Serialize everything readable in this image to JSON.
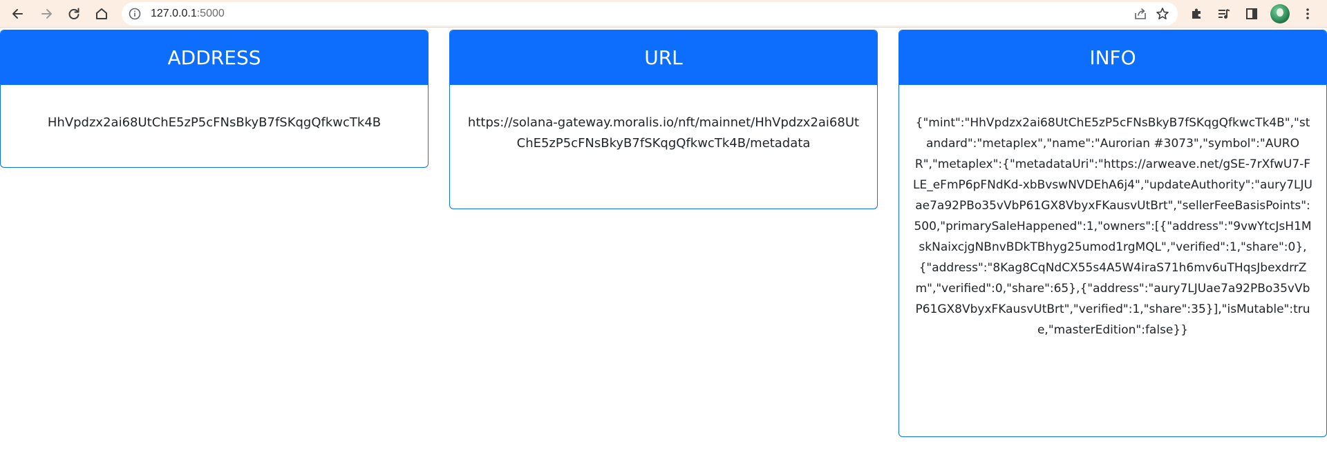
{
  "browser": {
    "address_host": "127.0.0.1",
    "address_port": ":5000",
    "icons": {
      "back": "arrow-left-icon",
      "forward": "arrow-right-icon",
      "reload": "reload-icon",
      "home": "home-icon",
      "site_info": "info-icon",
      "share": "share-icon",
      "bookmark": "star-icon",
      "extensions": "puzzle-icon",
      "media": "media-control-icon",
      "side_panel": "side-panel-icon",
      "menu": "kebab-menu-icon"
    }
  },
  "colors": {
    "accent": "#0d6efd",
    "toolbar": "#fdeee3"
  },
  "cards": {
    "address": {
      "title": "ADDRESS",
      "content": "HhVpdzx2ai68UtChE5zP5cFNsBkyB7fSKqgQfkwcTk4B"
    },
    "url": {
      "title": "URL",
      "content": "https://solana-gateway.moralis.io/nft/mainnet/HhVpdzx2ai68UtChE5zP5cFNsBkyB7fSKqgQfkwcTk4B/metadata"
    },
    "info": {
      "title": "INFO",
      "content": "{\"mint\":\"HhVpdzx2ai68UtChE5zP5cFNsBkyB7fSKqgQfkwcTk4B\",\"standard\":\"metaplex\",\"name\":\"Aurorian #3073\",\"symbol\":\"AUROR\",\"metaplex\":{\"metadataUri\":\"https://arweave.net/gSE-7rXfwU7-FLE_eFmP6pFNdKd-xbBvswNVDEhA6j4\",\"updateAuthority\":\"aury7LJUae7a92PBo35vVbP61GX8VbyxFKausvUtBrt\",\"sellerFeeBasisPoints\":500,\"primarySaleHappened\":1,\"owners\":[{\"address\":\"9vwYtcJsH1MskNaixcjgNBnvBDkTBhyg25umod1rgMQL\",\"verified\":1,\"share\":0},{\"address\":\"8Kag8CqNdCX55s4A5W4iraS71h6mv6uTHqsJbexdrrZm\",\"verified\":0,\"share\":65},{\"address\":\"aury7LJUae7a92PBo35vVbP61GX8VbyxFKausvUtBrt\",\"verified\":1,\"share\":35}],\"isMutable\":true,\"masterEdition\":false}}"
    }
  }
}
